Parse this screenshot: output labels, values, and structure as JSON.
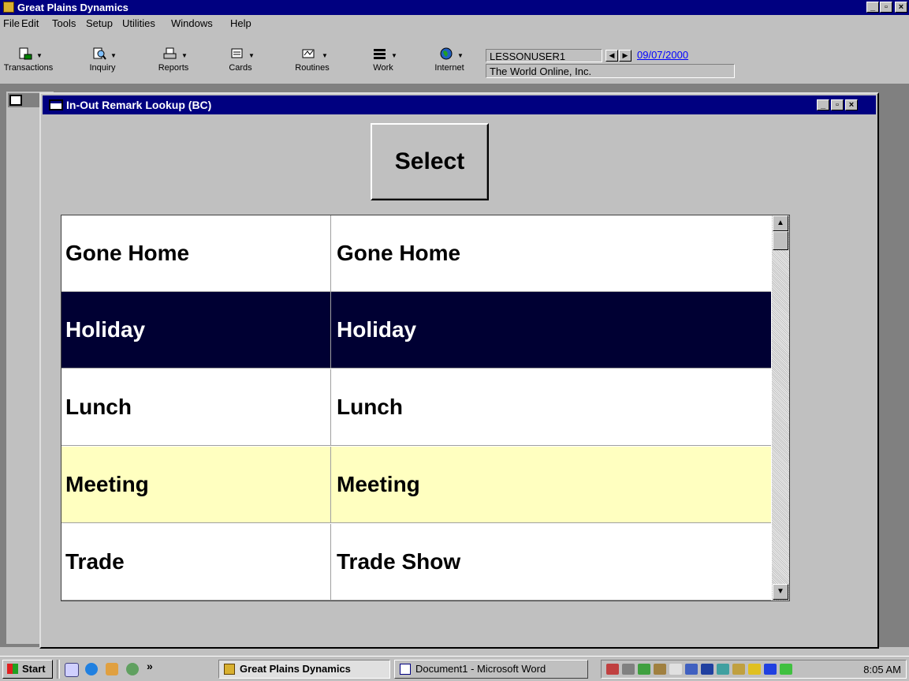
{
  "app": {
    "title": "Great Plains Dynamics",
    "controls": {
      "minimize": "_",
      "restore": "▫",
      "close": "×"
    }
  },
  "menu": [
    "File",
    "Edit",
    "Tools",
    "Setup",
    "Utilities",
    "Windows",
    "Help"
  ],
  "toolbar": {
    "buttons": [
      {
        "label": "Transactions",
        "icon": "transactions-icon"
      },
      {
        "label": "Inquiry",
        "icon": "inquiry-icon"
      },
      {
        "label": "Reports",
        "icon": "reports-icon"
      },
      {
        "label": "Cards",
        "icon": "cards-icon"
      },
      {
        "label": "Routines",
        "icon": "routines-icon"
      },
      {
        "label": "Work",
        "icon": "work-icon"
      },
      {
        "label": "Internet",
        "icon": "internet-icon"
      }
    ],
    "user": "LESSONUSER1",
    "date": "09/07/2000",
    "company": "The World Online, Inc."
  },
  "lookup": {
    "title": "In-Out Remark Lookup (BC)",
    "select_label": "Select",
    "rows": [
      {
        "id": "Gone Home",
        "description": "Gone Home",
        "state": "normal"
      },
      {
        "id": "Holiday",
        "description": "Holiday",
        "state": "selected"
      },
      {
        "id": "Lunch",
        "description": "Lunch",
        "state": "normal"
      },
      {
        "id": "Meeting",
        "description": "Meeting",
        "state": "highlight"
      },
      {
        "id": "Trade",
        "description": "Trade Show",
        "state": "normal"
      }
    ]
  },
  "colors": {
    "title_active": "#000080",
    "selected_row": "#000033",
    "highlight_row": "#ffffc0",
    "window_face": "#c0c0c0",
    "date_link": "#0000ff"
  },
  "taskbar": {
    "start_label": "Start",
    "chevron": "»",
    "tasks": [
      {
        "label": "Great Plains Dynamics",
        "active": true
      },
      {
        "label": "Document1 - Microsoft Word",
        "active": false
      }
    ],
    "clock": "8:05 AM"
  }
}
